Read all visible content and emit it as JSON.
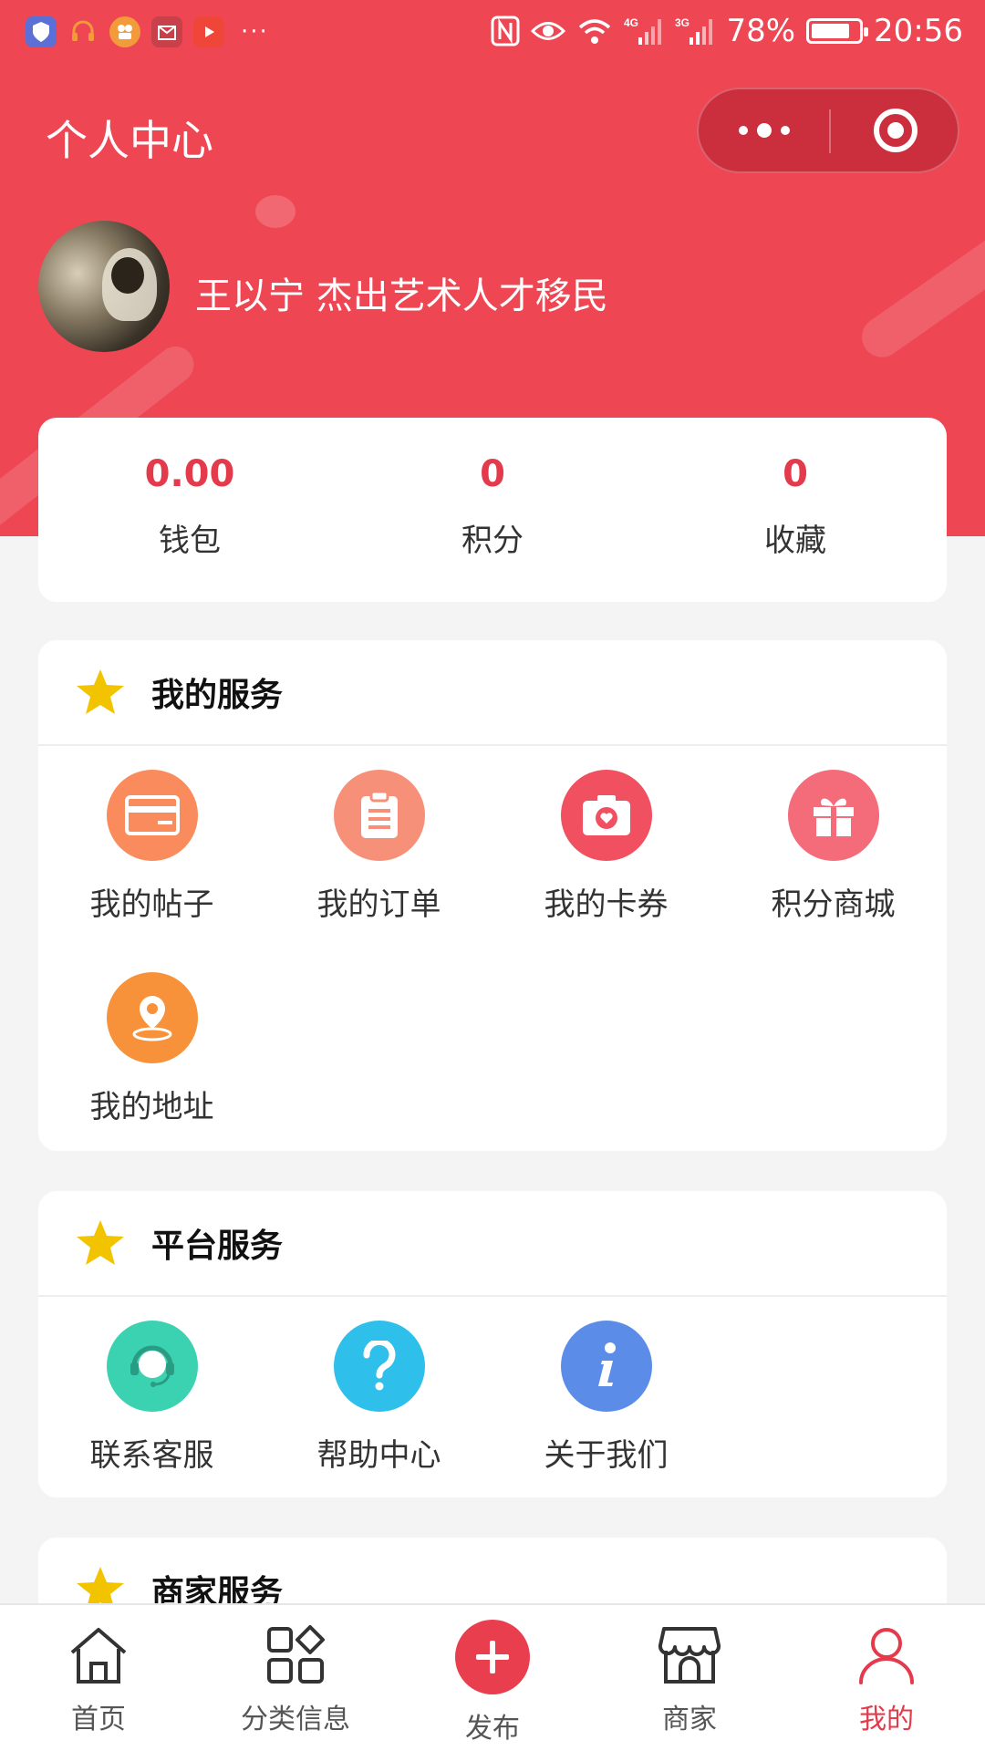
{
  "status_bar": {
    "battery": "78%",
    "time": "20:56",
    "net1": "4G",
    "net2": "3G"
  },
  "nav": {
    "title": "个人中心"
  },
  "profile": {
    "name": "王以宁 杰出艺术人才移民"
  },
  "stats": [
    {
      "value": "0.00",
      "label": "钱包"
    },
    {
      "value": "0",
      "label": "积分"
    },
    {
      "value": "0",
      "label": "收藏"
    }
  ],
  "my_services": {
    "title": "我的服务",
    "items": [
      {
        "label": "我的帖子",
        "icon": "card-icon",
        "color": "#f98b5c"
      },
      {
        "label": "我的订单",
        "icon": "clipboard-icon",
        "color": "#f79079"
      },
      {
        "label": "我的卡券",
        "icon": "camera-icon",
        "color": "#f0505f"
      },
      {
        "label": "积分商城",
        "icon": "gift-icon",
        "color": "#f46c7a"
      },
      {
        "label": "我的地址",
        "icon": "location-icon",
        "color": "#f7923a"
      }
    ]
  },
  "platform_services": {
    "title": "平台服务",
    "items": [
      {
        "label": "联系客服",
        "icon": "headset-icon",
        "color": "#3ad2b0"
      },
      {
        "label": "帮助中心",
        "icon": "question-icon",
        "color": "#2ec0ea"
      },
      {
        "label": "关于我们",
        "icon": "info-icon",
        "color": "#5b8de8"
      }
    ]
  },
  "merchant_services": {
    "title": "商家服务"
  },
  "tabbar": [
    {
      "label": "首页",
      "icon": "home-icon"
    },
    {
      "label": "分类信息",
      "icon": "category-icon"
    },
    {
      "label": "发布",
      "icon": "plus-icon"
    },
    {
      "label": "商家",
      "icon": "store-icon"
    },
    {
      "label": "我的",
      "icon": "user-icon",
      "active": true
    }
  ],
  "colors": {
    "brand": "#ee4653",
    "accent": "#e33a4c",
    "star": "#f2c400"
  }
}
